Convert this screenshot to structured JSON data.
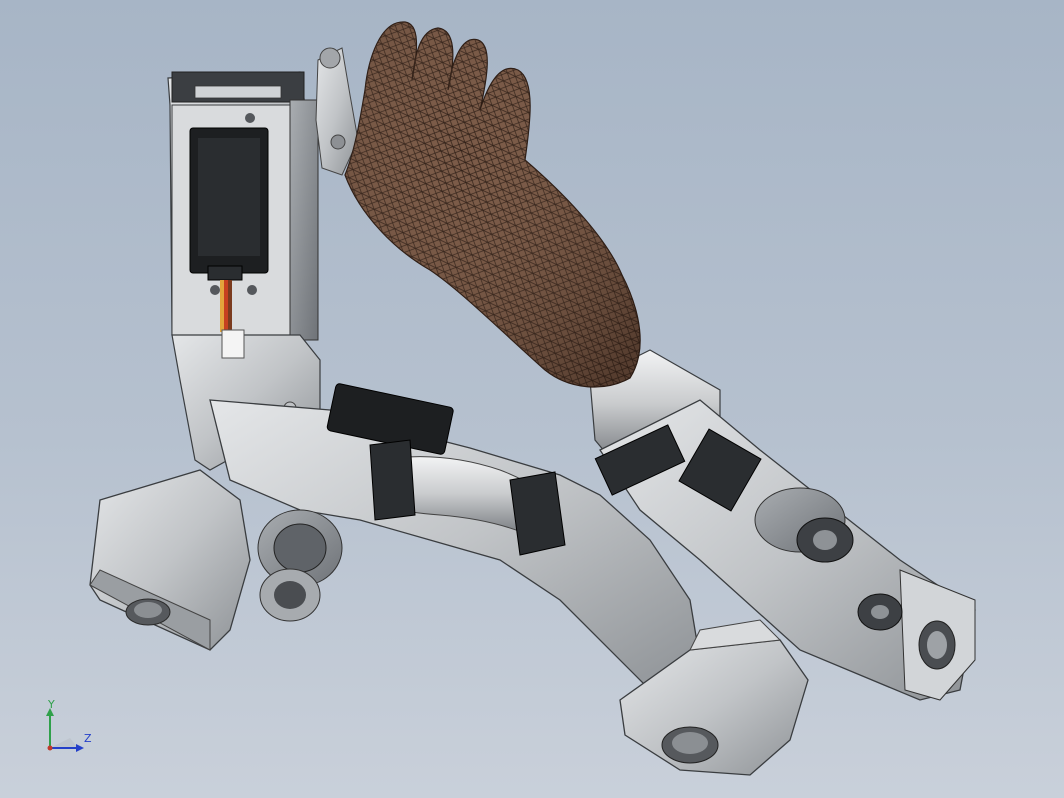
{
  "viewport": {
    "background_top": "#a7b5c6",
    "background_bottom": "#c9d0da"
  },
  "model": {
    "parts": [
      "servo-mount",
      "servo-motor",
      "servo-cable",
      "wrist-connector",
      "hand-mesh",
      "forearm",
      "elbow-joint",
      "upper-arm-link",
      "timing-pulley",
      "bearing-housing",
      "shoulder-bracket"
    ],
    "metal_color": "#c7cacd",
    "servo_color": "#1d1f21",
    "mesh_color": "#6b4d3c",
    "cable_colors": [
      "#e2a53b",
      "#c6411f",
      "#7a3b1e"
    ]
  },
  "triad": {
    "y_label": "Y",
    "z_label": "Z",
    "y_color": "#2fa04a",
    "z_color": "#2440c9",
    "origin_color": "#c0392b"
  }
}
